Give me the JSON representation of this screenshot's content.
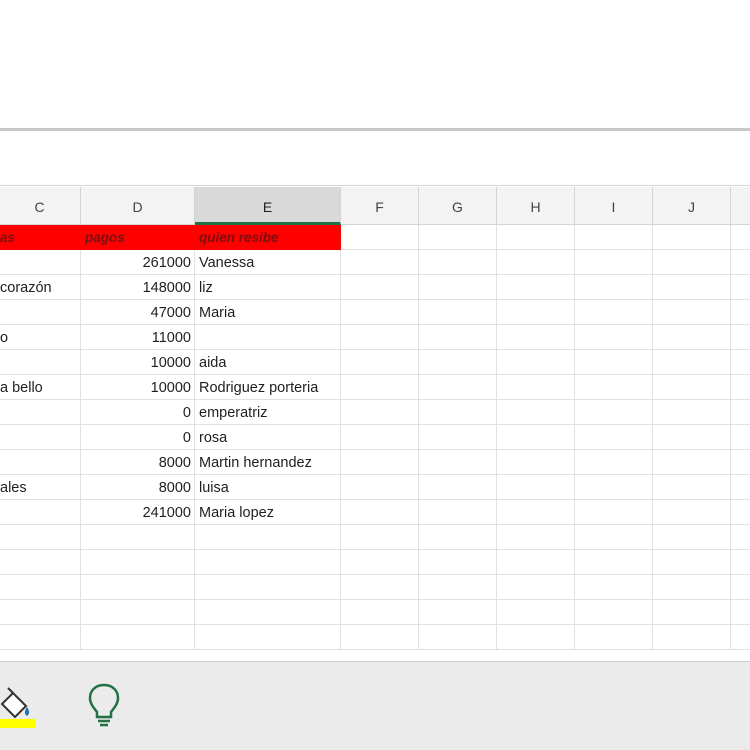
{
  "columns": [
    "C",
    "D",
    "E",
    "F",
    "G",
    "H",
    "I",
    "J"
  ],
  "selected_column": "E",
  "header_row": {
    "c": "as",
    "d": "pagos",
    "e": "quien resibe"
  },
  "rows": [
    {
      "c": "",
      "d": "261000",
      "e": "Vanessa"
    },
    {
      "c": "corazón",
      "d": "148000",
      "e": "liz"
    },
    {
      "c": "",
      "d": "47000",
      "e": "Maria"
    },
    {
      "c": "o",
      "d": "11000",
      "e": ""
    },
    {
      "c": "",
      "d": "10000",
      "e": "aida"
    },
    {
      "c": "a bello",
      "d": "10000",
      "e": "Rodriguez porteria"
    },
    {
      "c": "",
      "d": "0",
      "e": "emperatriz"
    },
    {
      "c": "",
      "d": "0",
      "e": "rosa"
    },
    {
      "c": "",
      "d": "8000",
      "e": "Martin hernandez"
    },
    {
      "c": "ales",
      "d": "8000",
      "e": "luisa"
    },
    {
      "c": "",
      "d": "241000",
      "e": "Maria lopez"
    }
  ],
  "toolbar": {
    "fill_color_icon": "paint-bucket-icon",
    "fill_color_swatch": "#ffff00",
    "ideas_icon": "lightbulb-icon"
  },
  "colors": {
    "header_fill": "#ff0000",
    "selected_column_accent": "#217346",
    "lightbulb": "#217346"
  }
}
